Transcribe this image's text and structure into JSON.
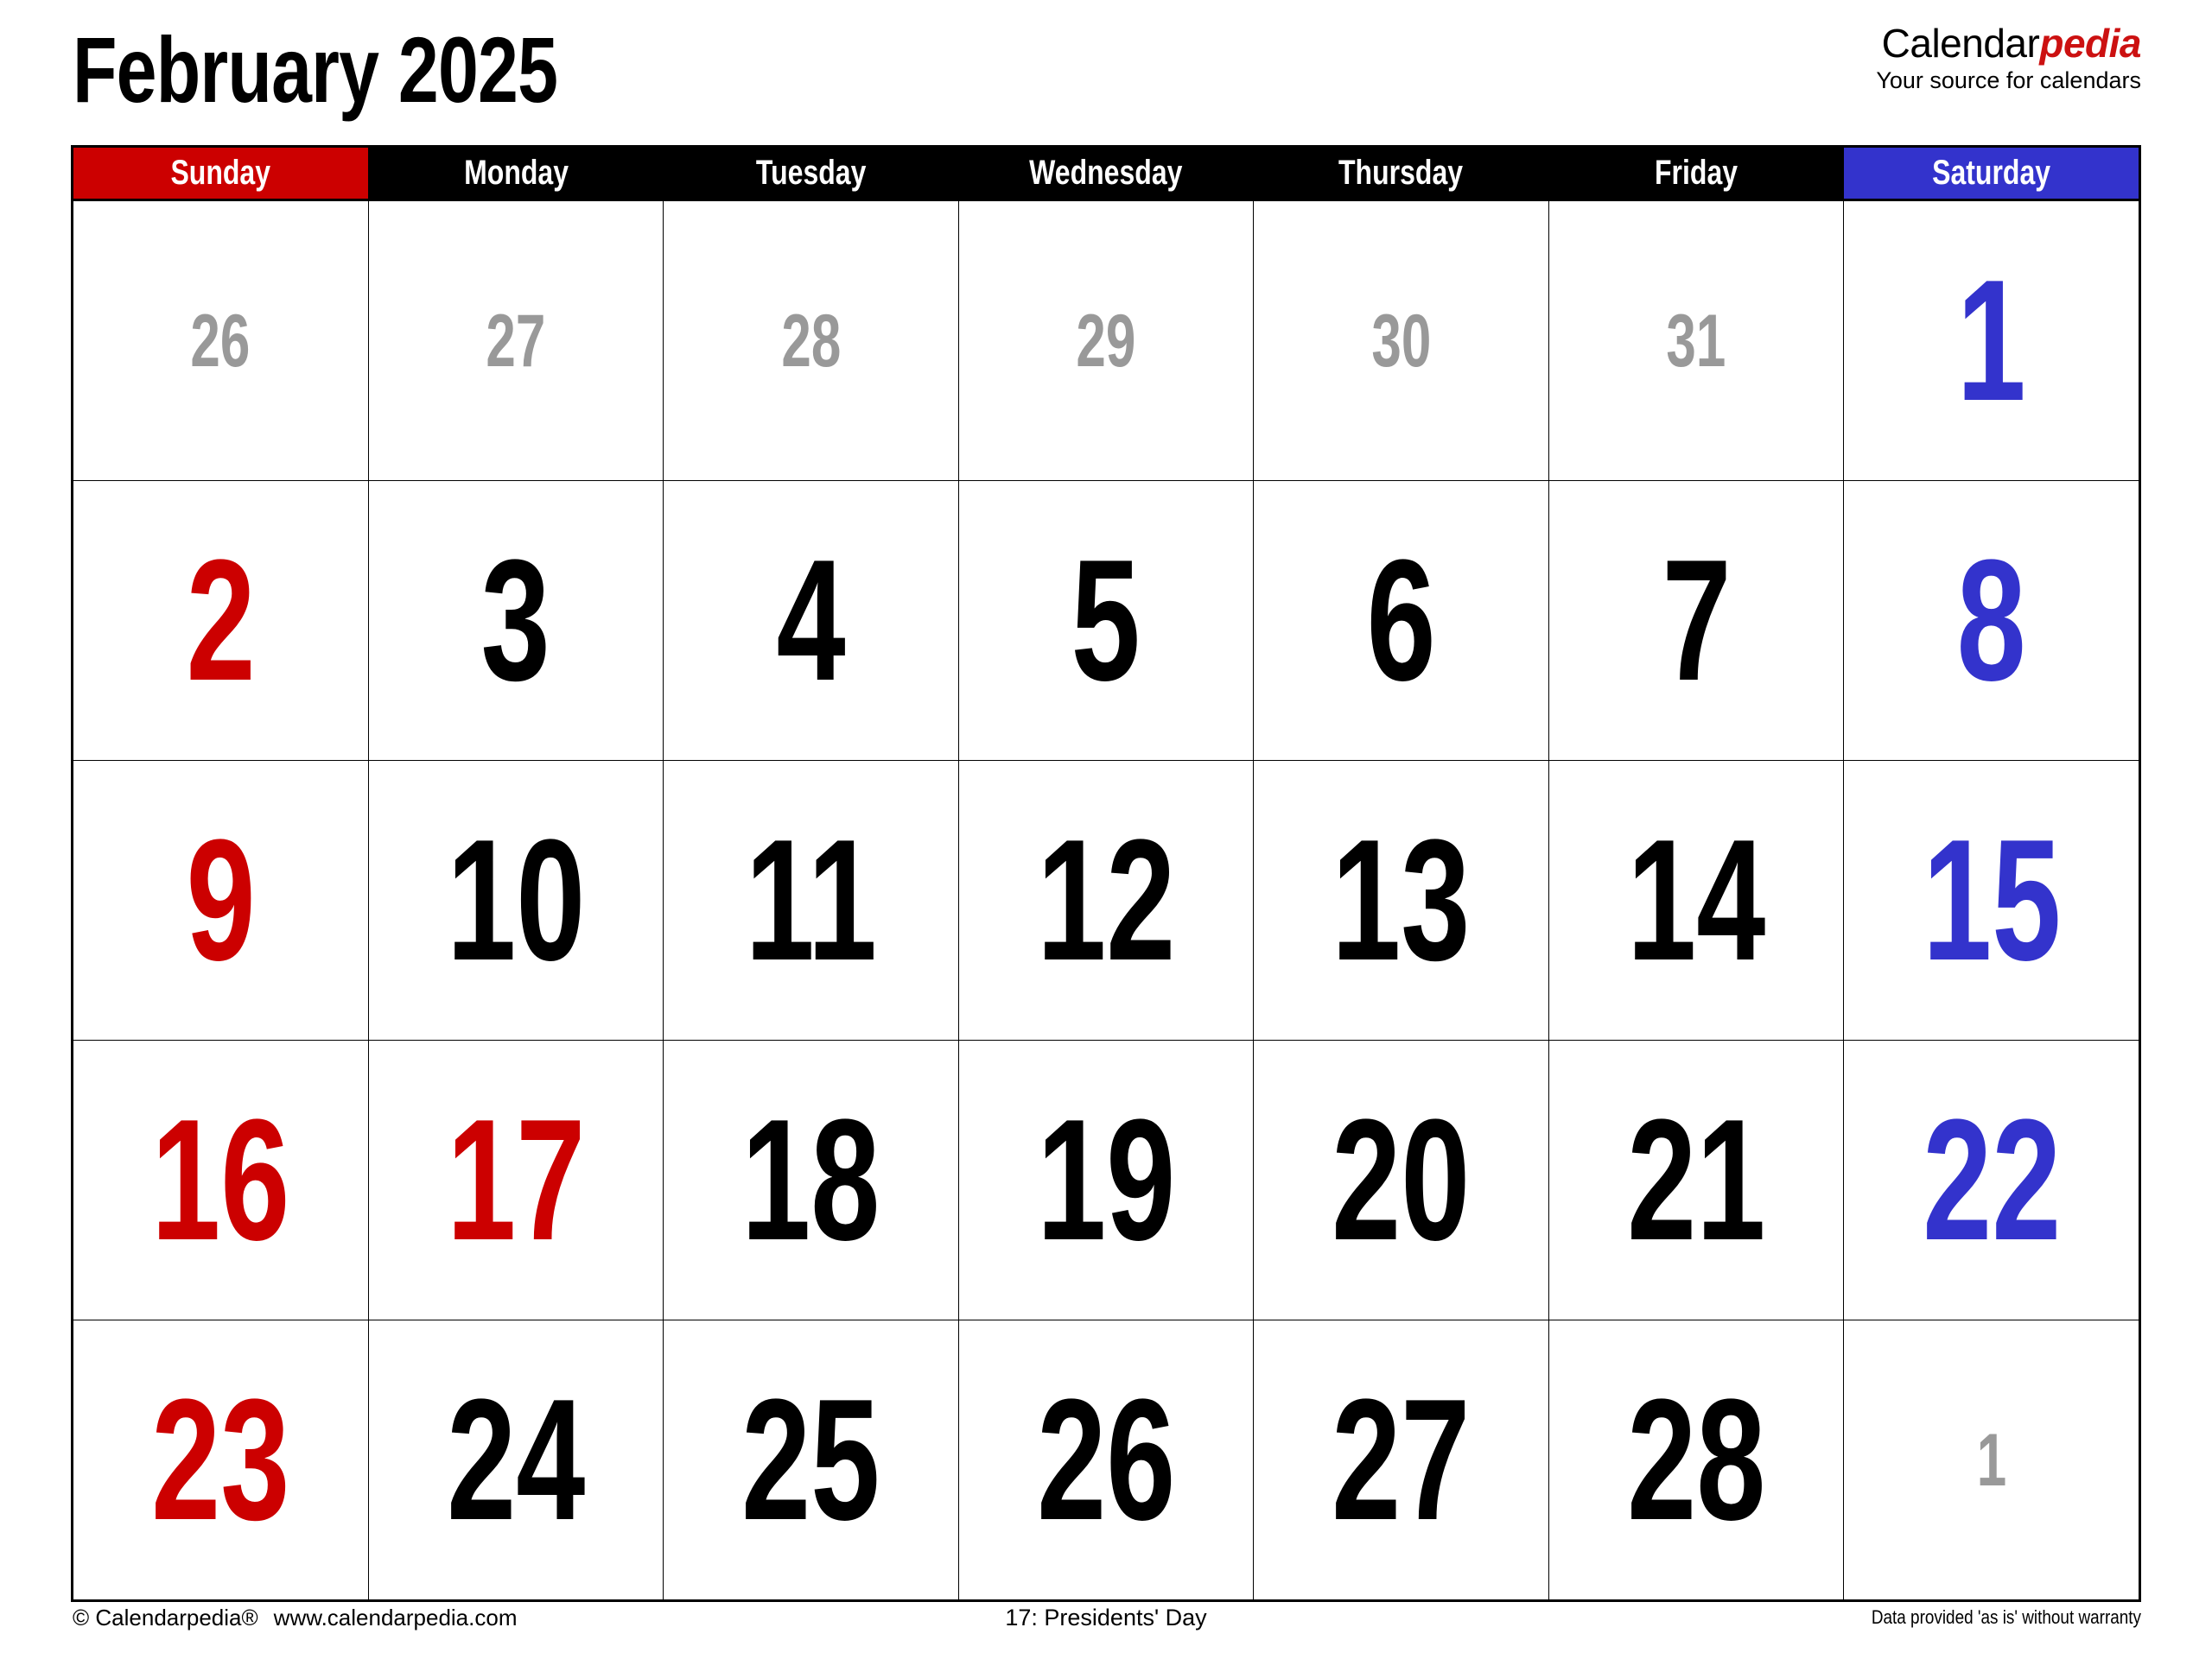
{
  "title": "February 2025",
  "brand": {
    "name_part1": "Calendar",
    "name_part2": "pedia",
    "tagline": "Your source for calendars"
  },
  "colors": {
    "sunday_header_bg": "#CC0000",
    "saturday_header_bg": "#3333CC",
    "weekday_header_bg": "#000000",
    "weekday_header_text": "#FFFFFF",
    "sunday_date": "#CC0000",
    "saturday_date": "#3333CC",
    "weekday_date": "#000000",
    "adjacent_month_date": "#999999",
    "holiday_date": "#CC0000"
  },
  "weekdays": [
    {
      "label": "Sunday",
      "style": "sunday"
    },
    {
      "label": "Monday",
      "style": "weekday"
    },
    {
      "label": "Tuesday",
      "style": "weekday"
    },
    {
      "label": "Wednesday",
      "style": "weekday"
    },
    {
      "label": "Thursday",
      "style": "weekday"
    },
    {
      "label": "Friday",
      "style": "weekday"
    },
    {
      "label": "Saturday",
      "style": "saturday"
    }
  ],
  "weeks": [
    [
      {
        "day": "26",
        "kind": "other",
        "color": "grey"
      },
      {
        "day": "27",
        "kind": "other",
        "color": "grey"
      },
      {
        "day": "28",
        "kind": "other",
        "color": "grey"
      },
      {
        "day": "29",
        "kind": "other",
        "color": "grey"
      },
      {
        "day": "30",
        "kind": "other",
        "color": "grey"
      },
      {
        "day": "31",
        "kind": "other",
        "color": "grey"
      },
      {
        "day": "1",
        "kind": "current",
        "color": "blue"
      }
    ],
    [
      {
        "day": "2",
        "kind": "current",
        "color": "red"
      },
      {
        "day": "3",
        "kind": "current",
        "color": "black"
      },
      {
        "day": "4",
        "kind": "current",
        "color": "black"
      },
      {
        "day": "5",
        "kind": "current",
        "color": "black"
      },
      {
        "day": "6",
        "kind": "current",
        "color": "black"
      },
      {
        "day": "7",
        "kind": "current",
        "color": "black"
      },
      {
        "day": "8",
        "kind": "current",
        "color": "blue"
      }
    ],
    [
      {
        "day": "9",
        "kind": "current",
        "color": "red"
      },
      {
        "day": "10",
        "kind": "current",
        "color": "black"
      },
      {
        "day": "11",
        "kind": "current",
        "color": "black"
      },
      {
        "day": "12",
        "kind": "current",
        "color": "black"
      },
      {
        "day": "13",
        "kind": "current",
        "color": "black"
      },
      {
        "day": "14",
        "kind": "current",
        "color": "black"
      },
      {
        "day": "15",
        "kind": "current",
        "color": "blue"
      }
    ],
    [
      {
        "day": "16",
        "kind": "current",
        "color": "red"
      },
      {
        "day": "17",
        "kind": "current",
        "color": "red"
      },
      {
        "day": "18",
        "kind": "current",
        "color": "black"
      },
      {
        "day": "19",
        "kind": "current",
        "color": "black"
      },
      {
        "day": "20",
        "kind": "current",
        "color": "black"
      },
      {
        "day": "21",
        "kind": "current",
        "color": "black"
      },
      {
        "day": "22",
        "kind": "current",
        "color": "blue"
      }
    ],
    [
      {
        "day": "23",
        "kind": "current",
        "color": "red"
      },
      {
        "day": "24",
        "kind": "current",
        "color": "black"
      },
      {
        "day": "25",
        "kind": "current",
        "color": "black"
      },
      {
        "day": "26",
        "kind": "current",
        "color": "black"
      },
      {
        "day": "27",
        "kind": "current",
        "color": "black"
      },
      {
        "day": "28",
        "kind": "current",
        "color": "black"
      },
      {
        "day": "1",
        "kind": "other",
        "color": "grey"
      }
    ]
  ],
  "footer": {
    "copyright": "© Calendarpedia®",
    "website": "www.calendarpedia.com",
    "holidays": "17: Presidents' Day",
    "disclaimer": "Data provided 'as is' without warranty"
  }
}
